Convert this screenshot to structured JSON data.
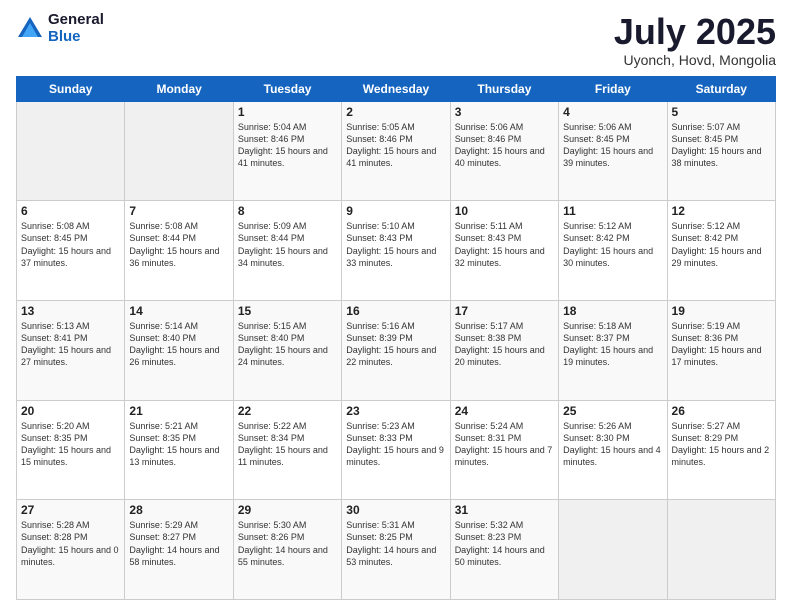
{
  "header": {
    "logo_general": "General",
    "logo_blue": "Blue",
    "month": "July 2025",
    "location": "Uyonch, Hovd, Mongolia"
  },
  "days_of_week": [
    "Sunday",
    "Monday",
    "Tuesday",
    "Wednesday",
    "Thursday",
    "Friday",
    "Saturday"
  ],
  "weeks": [
    [
      {
        "day": "",
        "sunrise": "",
        "sunset": "",
        "daylight": ""
      },
      {
        "day": "",
        "sunrise": "",
        "sunset": "",
        "daylight": ""
      },
      {
        "day": "1",
        "sunrise": "Sunrise: 5:04 AM",
        "sunset": "Sunset: 8:46 PM",
        "daylight": "Daylight: 15 hours and 41 minutes."
      },
      {
        "day": "2",
        "sunrise": "Sunrise: 5:05 AM",
        "sunset": "Sunset: 8:46 PM",
        "daylight": "Daylight: 15 hours and 41 minutes."
      },
      {
        "day": "3",
        "sunrise": "Sunrise: 5:06 AM",
        "sunset": "Sunset: 8:46 PM",
        "daylight": "Daylight: 15 hours and 40 minutes."
      },
      {
        "day": "4",
        "sunrise": "Sunrise: 5:06 AM",
        "sunset": "Sunset: 8:45 PM",
        "daylight": "Daylight: 15 hours and 39 minutes."
      },
      {
        "day": "5",
        "sunrise": "Sunrise: 5:07 AM",
        "sunset": "Sunset: 8:45 PM",
        "daylight": "Daylight: 15 hours and 38 minutes."
      }
    ],
    [
      {
        "day": "6",
        "sunrise": "Sunrise: 5:08 AM",
        "sunset": "Sunset: 8:45 PM",
        "daylight": "Daylight: 15 hours and 37 minutes."
      },
      {
        "day": "7",
        "sunrise": "Sunrise: 5:08 AM",
        "sunset": "Sunset: 8:44 PM",
        "daylight": "Daylight: 15 hours and 36 minutes."
      },
      {
        "day": "8",
        "sunrise": "Sunrise: 5:09 AM",
        "sunset": "Sunset: 8:44 PM",
        "daylight": "Daylight: 15 hours and 34 minutes."
      },
      {
        "day": "9",
        "sunrise": "Sunrise: 5:10 AM",
        "sunset": "Sunset: 8:43 PM",
        "daylight": "Daylight: 15 hours and 33 minutes."
      },
      {
        "day": "10",
        "sunrise": "Sunrise: 5:11 AM",
        "sunset": "Sunset: 8:43 PM",
        "daylight": "Daylight: 15 hours and 32 minutes."
      },
      {
        "day": "11",
        "sunrise": "Sunrise: 5:12 AM",
        "sunset": "Sunset: 8:42 PM",
        "daylight": "Daylight: 15 hours and 30 minutes."
      },
      {
        "day": "12",
        "sunrise": "Sunrise: 5:12 AM",
        "sunset": "Sunset: 8:42 PM",
        "daylight": "Daylight: 15 hours and 29 minutes."
      }
    ],
    [
      {
        "day": "13",
        "sunrise": "Sunrise: 5:13 AM",
        "sunset": "Sunset: 8:41 PM",
        "daylight": "Daylight: 15 hours and 27 minutes."
      },
      {
        "day": "14",
        "sunrise": "Sunrise: 5:14 AM",
        "sunset": "Sunset: 8:40 PM",
        "daylight": "Daylight: 15 hours and 26 minutes."
      },
      {
        "day": "15",
        "sunrise": "Sunrise: 5:15 AM",
        "sunset": "Sunset: 8:40 PM",
        "daylight": "Daylight: 15 hours and 24 minutes."
      },
      {
        "day": "16",
        "sunrise": "Sunrise: 5:16 AM",
        "sunset": "Sunset: 8:39 PM",
        "daylight": "Daylight: 15 hours and 22 minutes."
      },
      {
        "day": "17",
        "sunrise": "Sunrise: 5:17 AM",
        "sunset": "Sunset: 8:38 PM",
        "daylight": "Daylight: 15 hours and 20 minutes."
      },
      {
        "day": "18",
        "sunrise": "Sunrise: 5:18 AM",
        "sunset": "Sunset: 8:37 PM",
        "daylight": "Daylight: 15 hours and 19 minutes."
      },
      {
        "day": "19",
        "sunrise": "Sunrise: 5:19 AM",
        "sunset": "Sunset: 8:36 PM",
        "daylight": "Daylight: 15 hours and 17 minutes."
      }
    ],
    [
      {
        "day": "20",
        "sunrise": "Sunrise: 5:20 AM",
        "sunset": "Sunset: 8:35 PM",
        "daylight": "Daylight: 15 hours and 15 minutes."
      },
      {
        "day": "21",
        "sunrise": "Sunrise: 5:21 AM",
        "sunset": "Sunset: 8:35 PM",
        "daylight": "Daylight: 15 hours and 13 minutes."
      },
      {
        "day": "22",
        "sunrise": "Sunrise: 5:22 AM",
        "sunset": "Sunset: 8:34 PM",
        "daylight": "Daylight: 15 hours and 11 minutes."
      },
      {
        "day": "23",
        "sunrise": "Sunrise: 5:23 AM",
        "sunset": "Sunset: 8:33 PM",
        "daylight": "Daylight: 15 hours and 9 minutes."
      },
      {
        "day": "24",
        "sunrise": "Sunrise: 5:24 AM",
        "sunset": "Sunset: 8:31 PM",
        "daylight": "Daylight: 15 hours and 7 minutes."
      },
      {
        "day": "25",
        "sunrise": "Sunrise: 5:26 AM",
        "sunset": "Sunset: 8:30 PM",
        "daylight": "Daylight: 15 hours and 4 minutes."
      },
      {
        "day": "26",
        "sunrise": "Sunrise: 5:27 AM",
        "sunset": "Sunset: 8:29 PM",
        "daylight": "Daylight: 15 hours and 2 minutes."
      }
    ],
    [
      {
        "day": "27",
        "sunrise": "Sunrise: 5:28 AM",
        "sunset": "Sunset: 8:28 PM",
        "daylight": "Daylight: 15 hours and 0 minutes."
      },
      {
        "day": "28",
        "sunrise": "Sunrise: 5:29 AM",
        "sunset": "Sunset: 8:27 PM",
        "daylight": "Daylight: 14 hours and 58 minutes."
      },
      {
        "day": "29",
        "sunrise": "Sunrise: 5:30 AM",
        "sunset": "Sunset: 8:26 PM",
        "daylight": "Daylight: 14 hours and 55 minutes."
      },
      {
        "day": "30",
        "sunrise": "Sunrise: 5:31 AM",
        "sunset": "Sunset: 8:25 PM",
        "daylight": "Daylight: 14 hours and 53 minutes."
      },
      {
        "day": "31",
        "sunrise": "Sunrise: 5:32 AM",
        "sunset": "Sunset: 8:23 PM",
        "daylight": "Daylight: 14 hours and 50 minutes."
      },
      {
        "day": "",
        "sunrise": "",
        "sunset": "",
        "daylight": ""
      },
      {
        "day": "",
        "sunrise": "",
        "sunset": "",
        "daylight": ""
      }
    ]
  ]
}
